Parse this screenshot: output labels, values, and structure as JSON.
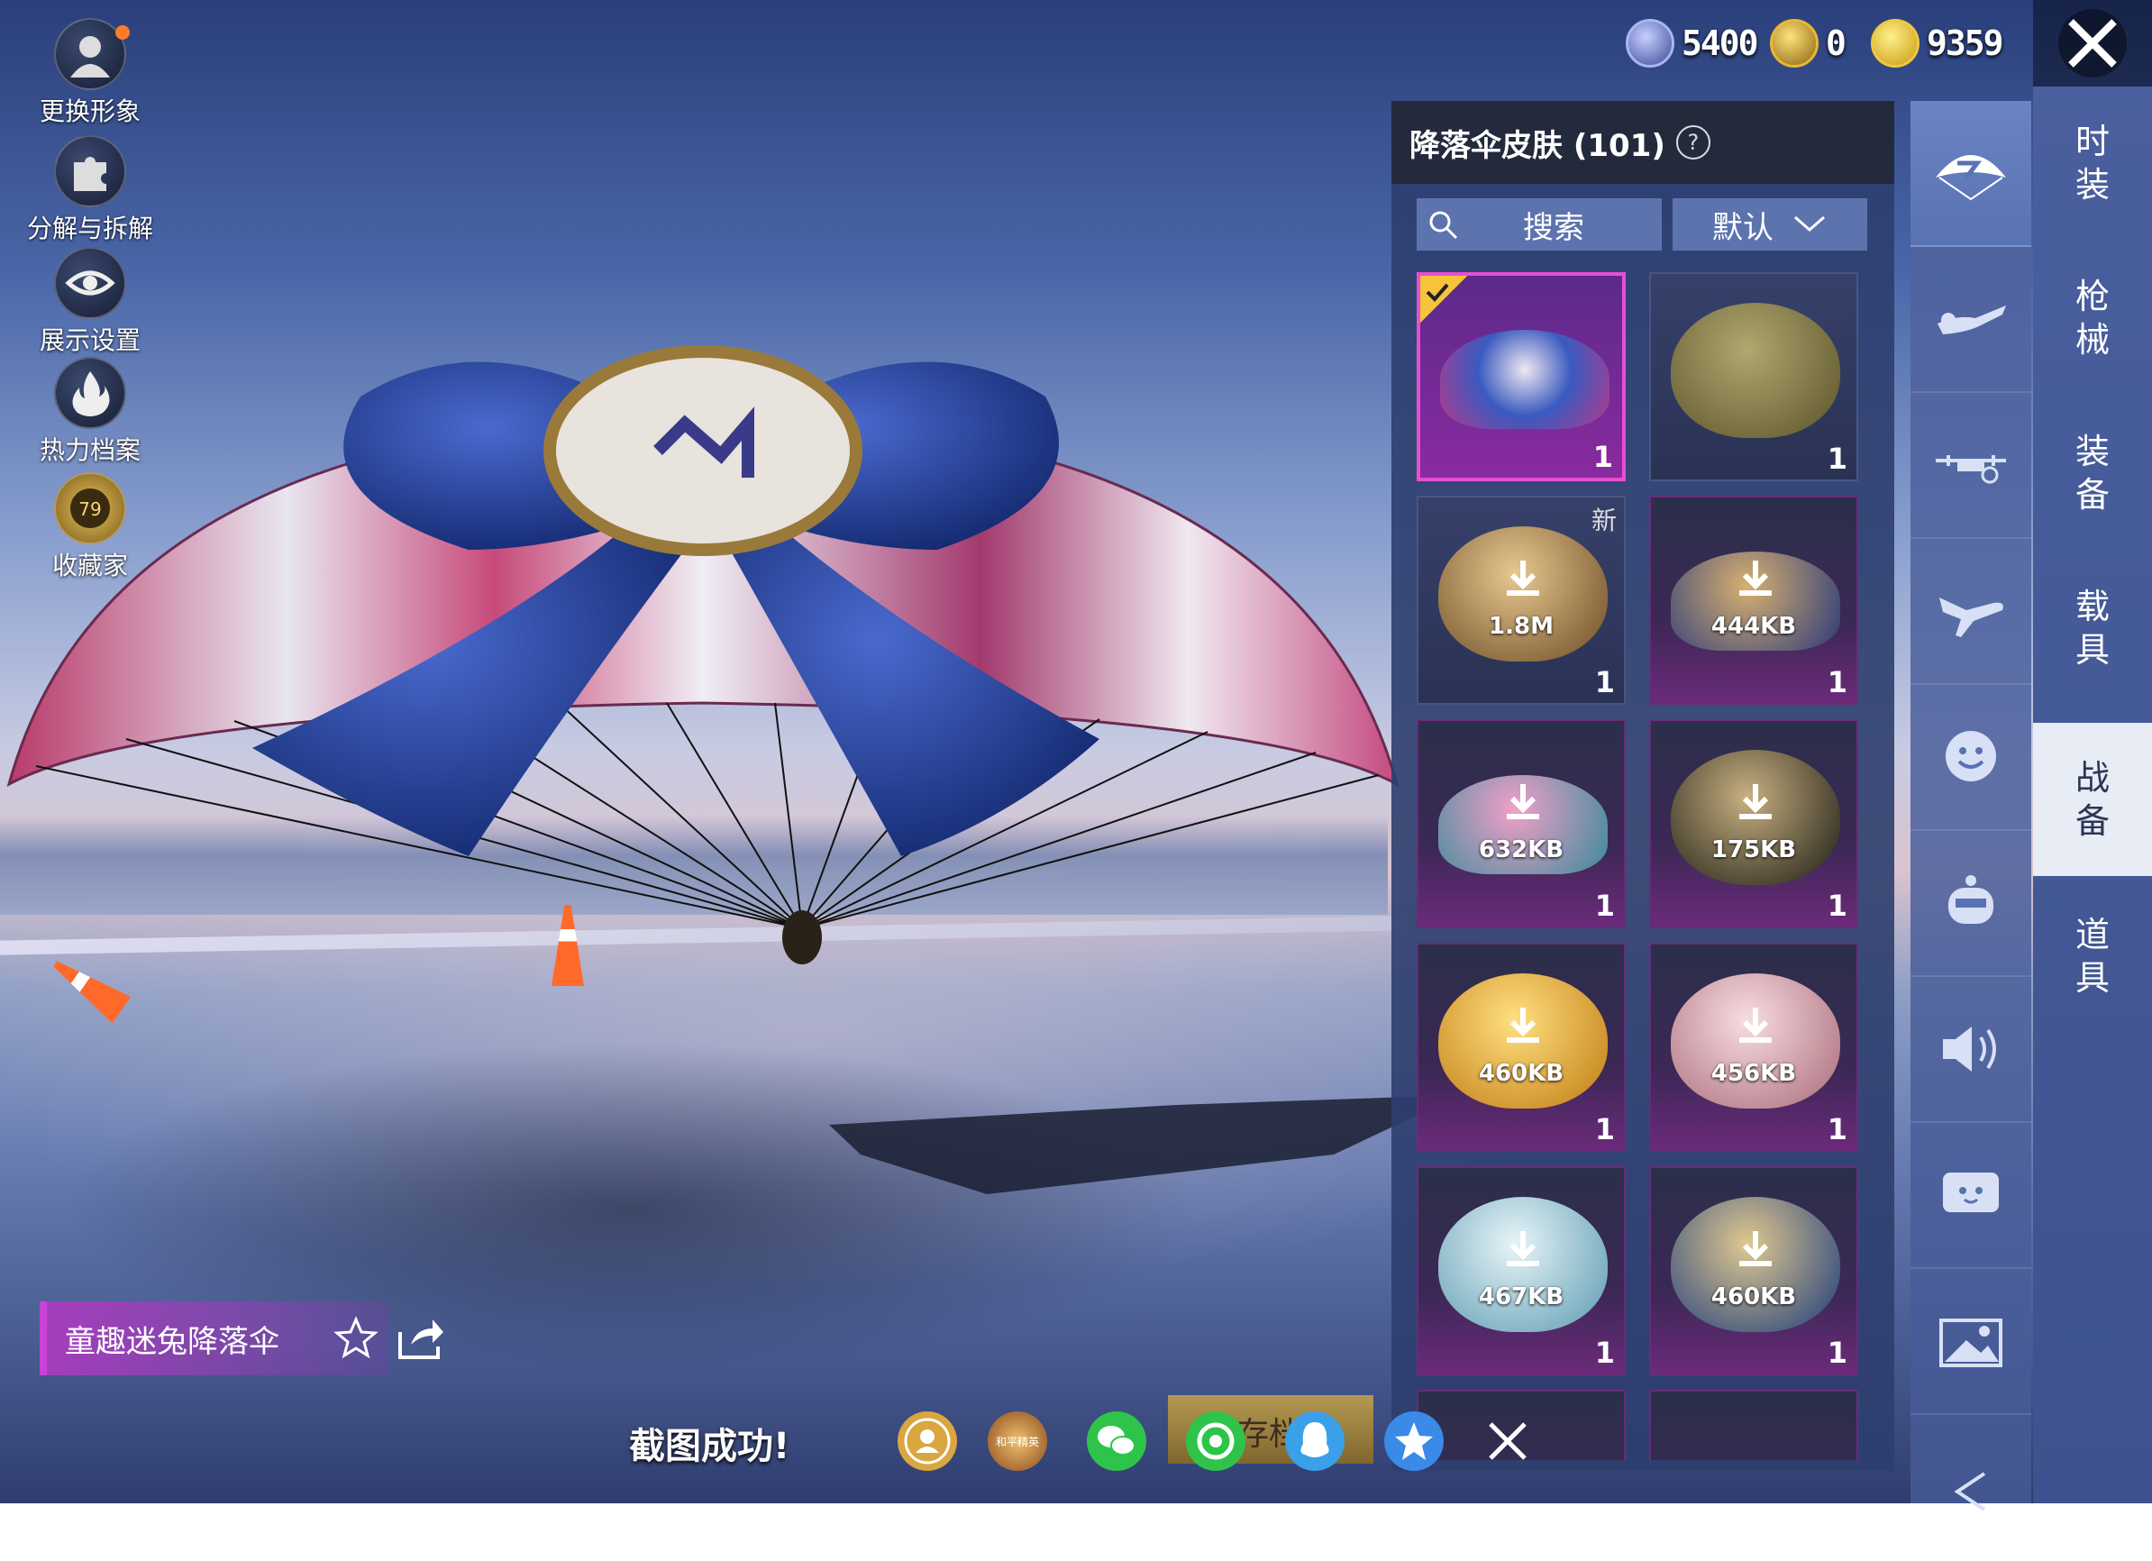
{
  "left_menu": [
    {
      "label": "更换形象",
      "icon": "avatar-icon"
    },
    {
      "label": "分解与拆解",
      "icon": "puzzle-icon"
    },
    {
      "label": "展示设置",
      "icon": "eye-icon"
    },
    {
      "label": "热力档案",
      "icon": "flame-icon"
    },
    {
      "label": "收藏家",
      "icon": "collector-badge-icon",
      "badge": "79"
    }
  ],
  "currency": [
    {
      "value": "5400",
      "icon": "token-coin-icon",
      "color": "#7c8bd6"
    },
    {
      "value": "0",
      "icon": "gold-coin-icon",
      "color": "#d6a628"
    },
    {
      "value": "9359",
      "icon": "lightning-coin-icon",
      "color": "#e8c23a"
    }
  ],
  "panel": {
    "title": "降落伞皮肤 (101)",
    "help": "?",
    "search_label": "搜索",
    "sort_label": "默认"
  },
  "items": [
    {
      "count": "1",
      "size": "",
      "selected": true,
      "new": false,
      "color": "#b63a8a"
    },
    {
      "count": "1",
      "size": "",
      "selected": false,
      "new": false,
      "color": "#7a6e3c"
    },
    {
      "count": "1",
      "size": "1.8M",
      "selected": false,
      "new": true,
      "new_label": "新",
      "color": "#8a6a40"
    },
    {
      "count": "1",
      "size": "444KB",
      "selected": false,
      "new": false,
      "color": "#8a6a40"
    },
    {
      "count": "1",
      "size": "632KB",
      "selected": false,
      "new": false,
      "color": "#c85a9a"
    },
    {
      "count": "1",
      "size": "175KB",
      "selected": false,
      "new": false,
      "color": "#5a4a2a"
    },
    {
      "count": "1",
      "size": "460KB",
      "selected": false,
      "new": false,
      "color": "#e2a825"
    },
    {
      "count": "1",
      "size": "456KB",
      "selected": false,
      "new": false,
      "color": "#d8a0aa"
    },
    {
      "count": "1",
      "size": "467KB",
      "selected": false,
      "new": false,
      "color": "#9cc8d8"
    },
    {
      "count": "1",
      "size": "460KB",
      "selected": false,
      "new": false,
      "color": "#2c4a8a"
    }
  ],
  "right_tabs": [
    {
      "label": "时装",
      "active": false
    },
    {
      "label": "枪械",
      "active": false
    },
    {
      "label": "装备",
      "active": false
    },
    {
      "label": "载具",
      "active": false
    },
    {
      "label": "战备",
      "active": true
    },
    {
      "label": "道具",
      "active": false
    }
  ],
  "icon_tabs": [
    "parachute-icon",
    "skydiver-icon",
    "drone-icon",
    "airplane-icon",
    "emote-face-icon",
    "robot-icon",
    "speaker-icon",
    "chat-bubble-icon",
    "picture-icon",
    "back-arrow-icon"
  ],
  "item_name": "童趣迷兔降落伞",
  "toast": {
    "text": "截图成功!",
    "save_label": "存档",
    "share_targets": [
      {
        "name": "avatar-share-icon",
        "color": "#d9a640"
      },
      {
        "name": "game-logo-icon",
        "color": "#c77a2a",
        "label": "和平精英"
      },
      {
        "name": "wechat-icon",
        "color": "#2ec449"
      },
      {
        "name": "moments-icon",
        "color": "#2ec449"
      },
      {
        "name": "qq-icon",
        "color": "#3aa0ea"
      },
      {
        "name": "qzone-icon",
        "color": "#3a8ae8"
      }
    ]
  }
}
